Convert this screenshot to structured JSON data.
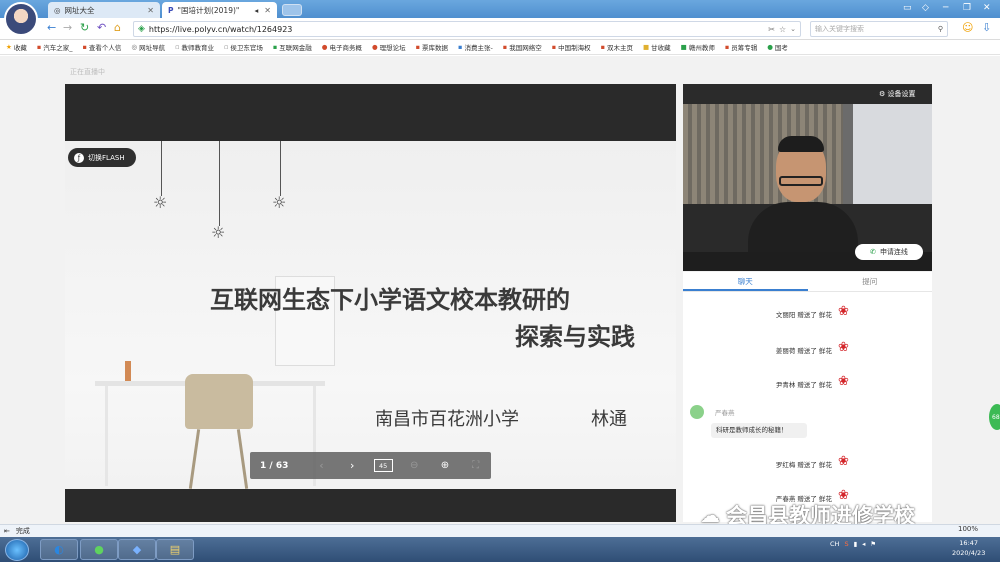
{
  "browser": {
    "tabs": [
      {
        "label": "网址大全",
        "icon": "globe-icon"
      },
      {
        "label": "\"国培计划(2019)\"",
        "icon": "polyv-icon",
        "active": true
      }
    ],
    "url": "https://live.polyv.cn/watch/1264923",
    "search_placeholder": "输入关键字搜索",
    "bookmarks": [
      "收藏",
      "汽车之家_",
      "查看个人信",
      "网址导航",
      "教师教育业",
      "侯卫东官场",
      "互联网金融",
      "电子商务概",
      "理想论坛",
      "票库数据",
      "消费主张-",
      "我国网络空",
      "中国制海权",
      "双木主页",
      "甘收藏",
      "赣州教师",
      "员筹专辑",
      "国考"
    ],
    "status_text": "完成",
    "zoom": "100%"
  },
  "player": {
    "live_label": "正在直播中",
    "flash_button": "切换FLASH",
    "slide": {
      "title_line1": "互联网生态下小学语文校本教研的",
      "title_line2": "探索与实践",
      "school": "南昌市百花洲小学",
      "author": "林通"
    },
    "page_indicator": "1 / 63",
    "zoom_value": "45",
    "device_settings": "设备设置",
    "apply_button": "申请连线"
  },
  "chat": {
    "tabs": [
      "聊天",
      "提问"
    ],
    "gifts": [
      {
        "text": "文丽阳  赠送了 鲜花"
      },
      {
        "text": "姜丽荷  赠送了 鲜花"
      },
      {
        "text": "尹青林  赠送了 鲜花"
      },
      {
        "text": "罗红梅  赠送了 鲜花"
      },
      {
        "text": "严春燕  赠送了 鲜花"
      }
    ],
    "message": {
      "user": "严春燕",
      "text": "科研是教师成长的秘籍！"
    },
    "side_badge": "68"
  },
  "watermark": "会昌县教师进修学校",
  "taskbar": {
    "tray_text": "CH",
    "time": "16:47",
    "date": "2020/4/23"
  },
  "colors": {
    "accent": "#3a7fd0",
    "rose": "#d4262b",
    "dark_band": "#2a2a2a"
  }
}
